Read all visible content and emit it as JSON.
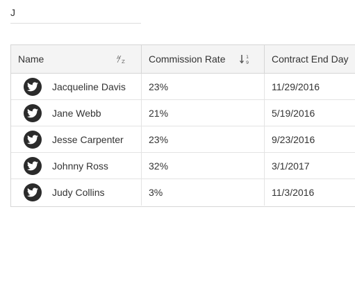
{
  "search": {
    "value": "J",
    "placeholder": ""
  },
  "grid": {
    "columns": [
      {
        "label": "Name",
        "sort_icon": "sort-alpha-icon"
      },
      {
        "label": "Commission Rate",
        "sort_icon": "sort-numeric-icon"
      },
      {
        "label": "Contract End Day"
      }
    ],
    "rows": [
      {
        "avatar_icon": "twitter-bird-icon",
        "name": "Jacqueline Davis",
        "commission": "23%",
        "end_day": "11/29/2016"
      },
      {
        "avatar_icon": "twitter-bird-icon",
        "name": "Jane Webb",
        "commission": "21%",
        "end_day": "5/19/2016"
      },
      {
        "avatar_icon": "twitter-bird-icon",
        "name": "Jesse Carpenter",
        "commission": "23%",
        "end_day": "9/23/2016"
      },
      {
        "avatar_icon": "twitter-bird-icon",
        "name": "Johnny Ross",
        "commission": "32%",
        "end_day": "3/1/2017"
      },
      {
        "avatar_icon": "twitter-bird-icon",
        "name": "Judy Collins",
        "commission": "3%",
        "end_day": "11/3/2016"
      }
    ]
  },
  "colors": {
    "header_bg": "#f4f4f4",
    "border": "#d6d6d6",
    "avatar_bg": "#2b2b2b",
    "text": "#333333"
  }
}
